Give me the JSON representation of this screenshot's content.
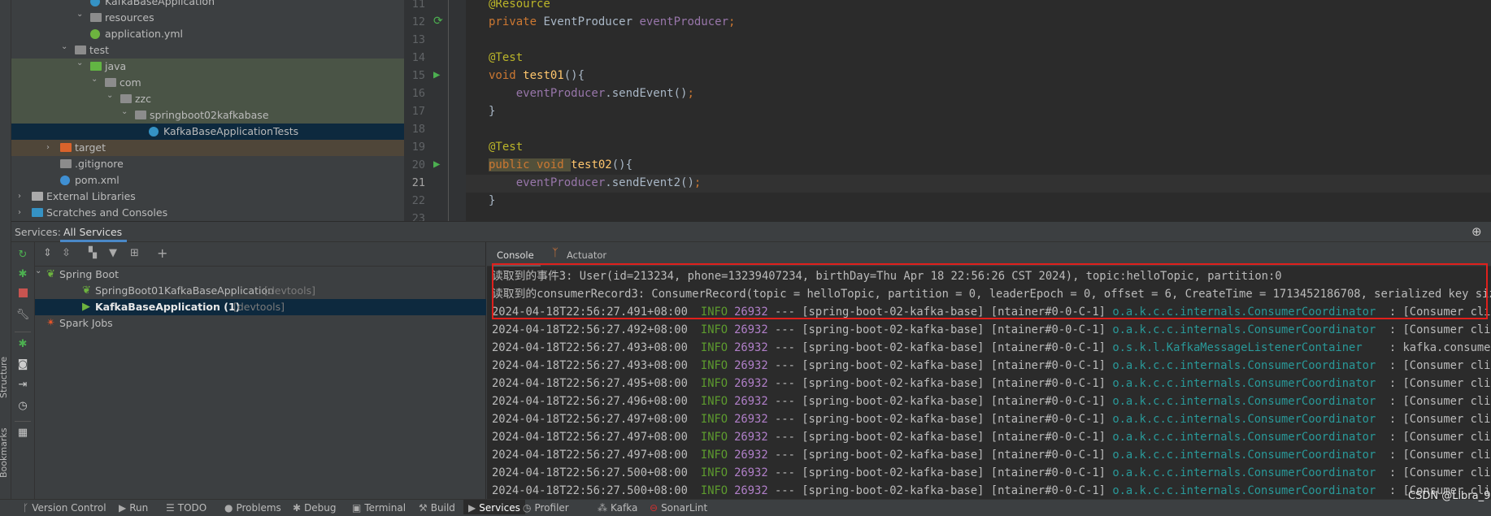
{
  "side_labels": {
    "structure": "Structure",
    "bookmarks": "Bookmarks"
  },
  "project_tree": [
    {
      "label": "KafkaBaseApplication",
      "icon": "spring-class-icon",
      "state": "normal"
    },
    {
      "label": "resources",
      "icon": "resources-folder-icon",
      "expanded": true
    },
    {
      "label": "application.yml",
      "icon": "spring-yaml-icon"
    },
    {
      "label": "test",
      "icon": "folder-icon",
      "expanded": true
    },
    {
      "label": "java",
      "icon": "test-folder-icon",
      "expanded": true,
      "highlight": "green"
    },
    {
      "label": "com",
      "icon": "package-icon",
      "expanded": true,
      "highlight": "green"
    },
    {
      "label": "zzc",
      "icon": "package-icon",
      "expanded": true,
      "highlight": "green"
    },
    {
      "label": "springboot02kafkabase",
      "icon": "package-icon",
      "expanded": true,
      "highlight": "green"
    },
    {
      "label": "KafkaBaseApplicationTests",
      "icon": "test-class-icon",
      "selected": true
    },
    {
      "label": "target",
      "icon": "excluded-folder-icon",
      "expanded": false,
      "highlight": "brown"
    },
    {
      "label": ".gitignore",
      "icon": "ignore-file-icon"
    },
    {
      "label": "pom.xml",
      "icon": "maven-icon"
    },
    {
      "label": "External Libraries",
      "icon": "libraries-icon",
      "expanded": false
    },
    {
      "label": "Scratches and Consoles",
      "icon": "scratches-icon",
      "expanded": false
    }
  ],
  "editor": {
    "lines": [
      {
        "n": "11",
        "tokens": [
          [
            "ann",
            "@Resource"
          ]
        ]
      },
      {
        "n": "12",
        "tokens": [
          [
            "kw",
            "private "
          ],
          [
            "",
            "EventProducer "
          ],
          [
            "fld",
            "eventProducer"
          ],
          [
            "kw",
            ";"
          ]
        ],
        "gutter": "spring-bean-icon"
      },
      {
        "n": "13",
        "tokens": []
      },
      {
        "n": "14",
        "tokens": [
          [
            "ann",
            "@Test"
          ]
        ]
      },
      {
        "n": "15",
        "tokens": [
          [
            "kw",
            "void "
          ],
          [
            "mth",
            "test01"
          ],
          [
            "",
            "(){"
          ]
        ],
        "gutter": "run-test-icon"
      },
      {
        "n": "16",
        "tokens": [
          [
            "",
            "    "
          ],
          [
            "fld",
            "eventProducer"
          ],
          [
            "",
            ".sendEvent()"
          ],
          [
            "kw",
            ";"
          ]
        ]
      },
      {
        "n": "17",
        "tokens": [
          [
            "",
            "}"
          ]
        ]
      },
      {
        "n": "18",
        "tokens": []
      },
      {
        "n": "19",
        "tokens": [
          [
            "ann",
            "@Test"
          ]
        ]
      },
      {
        "n": "20",
        "tokens": [
          [
            "kw",
            "public void "
          ],
          [
            "mth",
            "test02"
          ],
          [
            "",
            "(){"
          ]
        ],
        "gutter": "run-test-icon"
      },
      {
        "n": "21",
        "tokens": [
          [
            "",
            "    "
          ],
          [
            "fld",
            "eventProducer"
          ],
          [
            "",
            ".sendEvent2()"
          ],
          [
            "kw",
            ";"
          ]
        ],
        "current": true
      },
      {
        "n": "22",
        "tokens": [
          [
            "",
            "}"
          ]
        ]
      },
      {
        "n": "23",
        "tokens": []
      }
    ]
  },
  "services": {
    "label": "Services:",
    "tab": "All Services",
    "tree": [
      {
        "label": "Spring Boot",
        "icon": "spring-boot-icon",
        "expanded": true
      },
      {
        "label": "SpringBoot01KafkaBaseApplication",
        "suffix": "[devtools]",
        "icon": "spring-boot-icon"
      },
      {
        "label": "KafkaBaseApplication (1)",
        "suffix": "[devtools]",
        "icon": "running-icon",
        "selected": true
      },
      {
        "label": "Spark Jobs",
        "icon": "spark-icon"
      }
    ]
  },
  "console": {
    "tabs": [
      "Console",
      "Actuator"
    ],
    "active_tab": "Console",
    "lines": [
      {
        "text": "读取到的事件3: User(id=213234, phone=13239407234, birthDay=Thu Apr 18 22:56:26 CST 2024), topic:helloTopic, partition:0"
      },
      {
        "text": "读取到的consumerRecord3: ConsumerRecord(topic = helloTopic, partition = 0, leaderEpoch = 0, offset = 6, CreateTime = 1713452186708, serialized key size = "
      },
      {
        "time": "2024-04-18T22:56:27.491+08:00",
        "level": "INFO",
        "pid": "26932",
        "rest": " --- [spring-boot-02-kafka-base] [ntainer#0-0-C-1] ",
        "logger": "o.a.k.c.c.internals.ConsumerCoordinator  ",
        "msg": ": [Consumer clientId"
      },
      {
        "time": "2024-04-18T22:56:27.492+08:00",
        "level": "INFO",
        "pid": "26932",
        "rest": " --- [spring-boot-02-kafka-base] [ntainer#0-0-C-1] ",
        "logger": "o.a.k.c.c.internals.ConsumerCoordinator  ",
        "msg": ": [Consumer clientId"
      },
      {
        "time": "2024-04-18T22:56:27.493+08:00",
        "level": "INFO",
        "pid": "26932",
        "rest": " --- [spring-boot-02-kafka-base] [ntainer#0-0-C-1] ",
        "logger": "o.s.k.l.KafkaMessageListenerContainer    ",
        "msg": ": kafka.consumer.gro"
      },
      {
        "time": "2024-04-18T22:56:27.493+08:00",
        "level": "INFO",
        "pid": "26932",
        "rest": " --- [spring-boot-02-kafka-base] [ntainer#0-0-C-1] ",
        "logger": "o.a.k.c.c.internals.ConsumerCoordinator  ",
        "msg": ": [Consumer clientId"
      },
      {
        "time": "2024-04-18T22:56:27.495+08:00",
        "level": "INFO",
        "pid": "26932",
        "rest": " --- [spring-boot-02-kafka-base] [ntainer#0-0-C-1] ",
        "logger": "o.a.k.c.c.internals.ConsumerCoordinator  ",
        "msg": ": [Consumer clientId"
      },
      {
        "time": "2024-04-18T22:56:27.496+08:00",
        "level": "INFO",
        "pid": "26932",
        "rest": " --- [spring-boot-02-kafka-base] [ntainer#0-0-C-1] ",
        "logger": "o.a.k.c.c.internals.ConsumerCoordinator  ",
        "msg": ": [Consumer clientId"
      },
      {
        "time": "2024-04-18T22:56:27.497+08:00",
        "level": "INFO",
        "pid": "26932",
        "rest": " --- [spring-boot-02-kafka-base] [ntainer#0-0-C-1] ",
        "logger": "o.a.k.c.c.internals.ConsumerCoordinator  ",
        "msg": ": [Consumer clientId"
      },
      {
        "time": "2024-04-18T22:56:27.497+08:00",
        "level": "INFO",
        "pid": "26932",
        "rest": " --- [spring-boot-02-kafka-base] [ntainer#0-0-C-1] ",
        "logger": "o.a.k.c.c.internals.ConsumerCoordinator  ",
        "msg": ": [Consumer clientId"
      },
      {
        "time": "2024-04-18T22:56:27.497+08:00",
        "level": "INFO",
        "pid": "26932",
        "rest": " --- [spring-boot-02-kafka-base] [ntainer#0-0-C-1] ",
        "logger": "o.a.k.c.c.internals.ConsumerCoordinator  ",
        "msg": ": [Consumer clientId"
      },
      {
        "time": "2024-04-18T22:56:27.500+08:00",
        "level": "INFO",
        "pid": "26932",
        "rest": " --- [spring-boot-02-kafka-base] [ntainer#0-0-C-1] ",
        "logger": "o.a.k.c.c.internals.ConsumerCoordinator  ",
        "msg": ": [Consumer clientId"
      },
      {
        "time": "2024-04-18T22:56:27.500+08:00",
        "level": "INFO",
        "pid": "26932",
        "rest": " --- [spring-boot-02-kafka-base] [ntainer#0-0-C-1] ",
        "logger": "o.a.k.c.c.internals.ConsumerCoordinator  ",
        "msg": ": [Consumer clientId"
      }
    ]
  },
  "bottom_bar": [
    {
      "label": "Version Control",
      "icon": "version-control-icon"
    },
    {
      "label": "Run",
      "icon": "run-icon"
    },
    {
      "label": "TODO",
      "icon": "todo-icon"
    },
    {
      "label": "Problems",
      "icon": "problems-icon"
    },
    {
      "label": "Debug",
      "icon": "debug-icon"
    },
    {
      "label": "Terminal",
      "icon": "terminal-icon"
    },
    {
      "label": "Build",
      "icon": "build-icon"
    },
    {
      "label": "Services",
      "icon": "services-icon",
      "active": true
    },
    {
      "label": "Profiler",
      "icon": "profiler-icon"
    },
    {
      "label": "Kafka",
      "icon": "kafka-icon"
    },
    {
      "label": "SonarLint",
      "icon": "sonarlint-icon"
    }
  ],
  "watermark": "CSDN @Libra_97",
  "colors": {
    "highlight_box": "#e0201c",
    "selection": "#0d293e",
    "info": "#5d9b2e",
    "logger": "#299999",
    "pid": "#b07fc8"
  }
}
